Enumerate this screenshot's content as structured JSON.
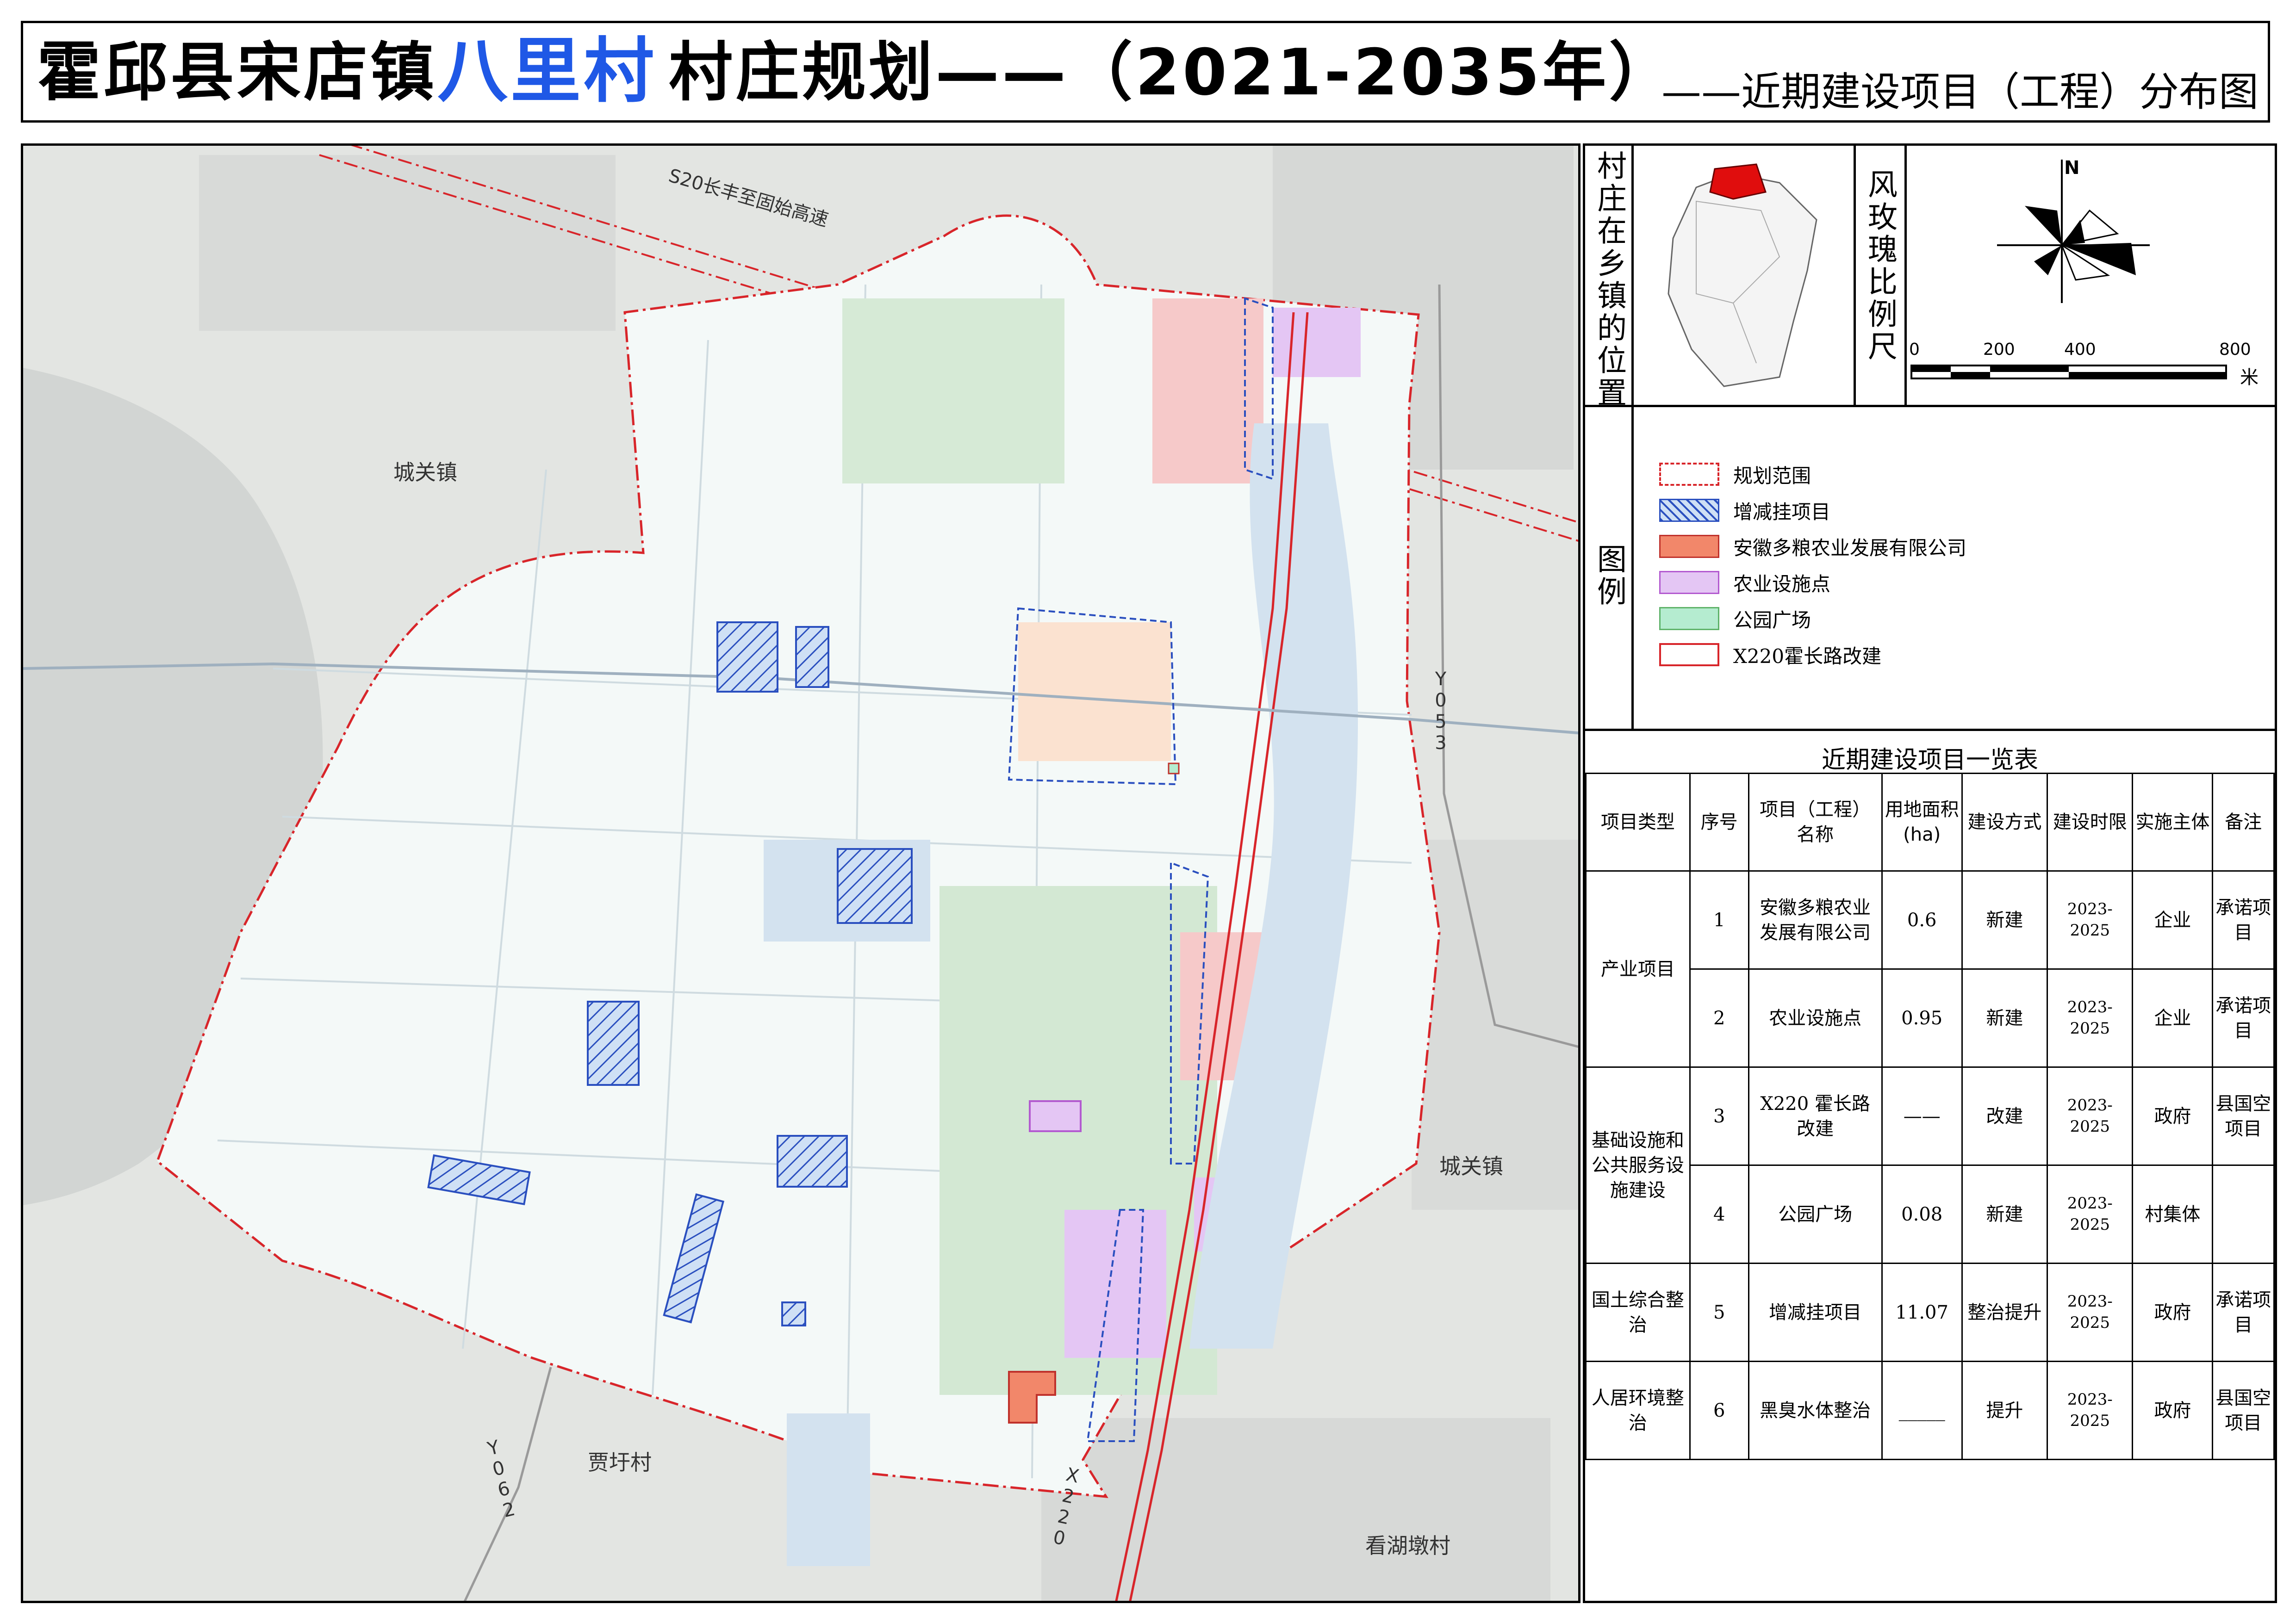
{
  "title": {
    "prefix": "霍邱县宋店镇",
    "village": "八里村",
    "suffix": "村庄规划——（2021-2035年）",
    "subtitle": "——近期建设项目（工程）分布图"
  },
  "map": {
    "road_labels": {
      "s20": "S20长丰至固始高速",
      "y053": "Y053",
      "y062": "Y062",
      "x220": "X220"
    },
    "place_labels": {
      "chengguan_west": "城关镇",
      "chengguan_east": "城关镇",
      "jiayu": "贾圩村",
      "kanhudun": "看湖墩村"
    }
  },
  "panel": {
    "location_title": "村庄在乡镇的位置",
    "scale_title": "风玫瑰比例尺",
    "north": "N",
    "scale_ticks": [
      "0",
      "200",
      "400",
      "800"
    ],
    "scale_unit": "米",
    "legend_title": "图例",
    "legend": [
      {
        "label": "规划范围",
        "stroke": "#d8252a",
        "fill": "#ffffff",
        "style": "dashdot"
      },
      {
        "label": "增减挂项目",
        "stroke": "#2a4fbf",
        "fill": "#cfe0f5",
        "style": "hatch"
      },
      {
        "label": "安徽多粮农业发展有限公司",
        "stroke": "#c0322c",
        "fill": "#f2876a",
        "style": "solid"
      },
      {
        "label": "农业设施点",
        "stroke": "#b35ad0",
        "fill": "#e4c6f4",
        "style": "solid"
      },
      {
        "label": "公园广场",
        "stroke": "#5fb36a",
        "fill": "#b5ecd0",
        "style": "solid"
      },
      {
        "label": "X220霍长路改建",
        "stroke": "#d8252a",
        "fill": "#ffffff",
        "style": "solid"
      }
    ]
  },
  "table": {
    "title": "近期建设项目一览表",
    "headers": [
      "项目类型",
      "序号",
      "项目（工程）名称",
      "用地面积(ha)",
      "建设方式",
      "建设时限",
      "实施主体",
      "备注"
    ],
    "categories": {
      "industry": "产业项目",
      "infra": "基础设施和公共服务设施建设",
      "land": "国土综合整治",
      "living": "人居环境整治"
    },
    "rows": [
      {
        "no": "1",
        "name": "安徽多粮农业发展有限公司",
        "area": "0.6",
        "method": "新建",
        "period": "2023-2025",
        "entity": "企业",
        "note": "承诺项目"
      },
      {
        "no": "2",
        "name": "农业设施点",
        "area": "0.95",
        "method": "新建",
        "period": "2023-2025",
        "entity": "企业",
        "note": "承诺项目"
      },
      {
        "no": "3",
        "name": "X220 霍长路改建",
        "area": "——",
        "method": "改建",
        "period": "2023-2025",
        "entity": "政府",
        "note": "县国空项目"
      },
      {
        "no": "4",
        "name": "公园广场",
        "area": "0.08",
        "method": "新建",
        "period": "2023-2025",
        "entity": "村集体",
        "note": ""
      },
      {
        "no": "5",
        "name": "增减挂项目",
        "area": "11.07",
        "method": "整治提升",
        "period": "2023-2025",
        "entity": "政府",
        "note": "承诺项目"
      },
      {
        "no": "6",
        "name": "黑臭水体整治",
        "area": "_____",
        "method": "提升",
        "period": "2023-2025",
        "entity": "政府",
        "note": "县国空项目"
      }
    ]
  }
}
